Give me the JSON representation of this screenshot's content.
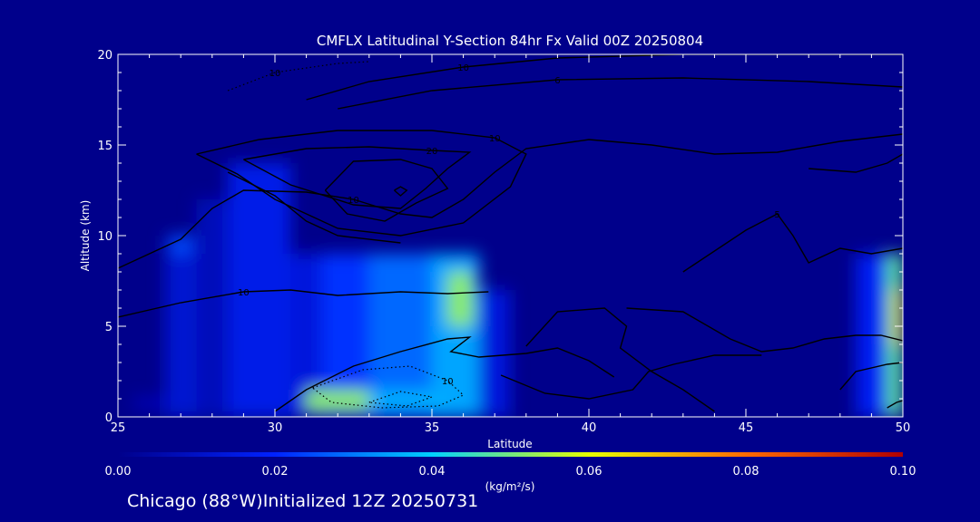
{
  "chart_data": {
    "type": "heatmap",
    "title": "CMFLX Latitudinal Y-Section 84hr  Fx Valid 00Z 20250804",
    "xlabel": "Latitude",
    "ylabel": "Altitude (km)",
    "xlim": [
      25,
      50
    ],
    "ylim": [
      0,
      20
    ],
    "x_ticks": [
      "25",
      "30",
      "35",
      "40",
      "45",
      "50"
    ],
    "y_ticks": [
      "0",
      "5",
      "10",
      "15",
      "20"
    ],
    "colorbar": {
      "ticks": [
        "0.00",
        "0.02",
        "0.04",
        "0.06",
        "0.08",
        "0.10"
      ],
      "range": [
        0,
        0.1
      ],
      "unit_label": "(kg/m²/s)"
    },
    "field_cells": [
      {
        "lat": [
          25.5,
          26.5
        ],
        "alt": [
          0.5,
          1.0
        ],
        "v": 0.01
      },
      {
        "lat": [
          26.5,
          27.5
        ],
        "alt": [
          0,
          10
        ],
        "v": 0.012
      },
      {
        "lat": [
          27.5,
          28.5
        ],
        "alt": [
          0,
          12
        ],
        "v": 0.008
      },
      {
        "lat": [
          28.5,
          30.5
        ],
        "alt": [
          0,
          14
        ],
        "v": 0.016
      },
      {
        "lat": [
          30.5,
          31.5
        ],
        "alt": [
          0,
          9
        ],
        "v": 0.014
      },
      {
        "lat": [
          31.5,
          33
        ],
        "alt": [
          0,
          9
        ],
        "v": 0.022
      },
      {
        "lat": [
          33,
          35
        ],
        "alt": [
          0,
          9
        ],
        "v": 0.028
      },
      {
        "lat": [
          35,
          36.5
        ],
        "alt": [
          0,
          9
        ],
        "v": 0.035
      },
      {
        "lat": [
          36.5,
          37.5
        ],
        "alt": [
          0,
          7
        ],
        "v": 0.014
      },
      {
        "lat": [
          31,
          33
        ],
        "alt": [
          0.3,
          1.5
        ],
        "v": 0.052
      },
      {
        "lat": [
          33,
          35.5
        ],
        "alt": [
          0.3,
          1.5
        ],
        "v": 0.036
      },
      {
        "lat": [
          35.5,
          36.3
        ],
        "alt": [
          5,
          8
        ],
        "v": 0.052
      },
      {
        "lat": [
          26.7,
          27.3
        ],
        "alt": [
          9,
          10
        ],
        "v": 0.025
      },
      {
        "lat": [
          48.5,
          49.5
        ],
        "alt": [
          0,
          9
        ],
        "v": 0.018
      },
      {
        "lat": [
          49.5,
          50
        ],
        "alt": [
          0,
          9
        ],
        "v": 0.048
      },
      {
        "lat": [
          49.7,
          50
        ],
        "alt": [
          4,
          7
        ],
        "v": 0.062
      }
    ],
    "contours": [
      {
        "label": "10",
        "points": [
          [
            25,
            8.2
          ],
          [
            27,
            9.8
          ],
          [
            28,
            11.5
          ],
          [
            29,
            12.5
          ],
          [
            31,
            12.4
          ],
          [
            32.5,
            12.0
          ],
          [
            34,
            11.2
          ],
          [
            35,
            11.0
          ],
          [
            36,
            12.0
          ],
          [
            37,
            13.5
          ],
          [
            38,
            14.8
          ],
          [
            40,
            15.3
          ],
          [
            42,
            15.0
          ],
          [
            44,
            14.5
          ],
          [
            46,
            14.6
          ],
          [
            48,
            15.2
          ],
          [
            50,
            15.6
          ]
        ]
      },
      {
        "label": "10",
        "points": [
          [
            31,
            17.5
          ],
          [
            33,
            18.5
          ],
          [
            36,
            19.3
          ],
          [
            39,
            19.8
          ],
          [
            43,
            20.0
          ],
          [
            47,
            20.0
          ],
          [
            50,
            20.0
          ]
        ]
      },
      {
        "label": "6",
        "points": [
          [
            32,
            17.0
          ],
          [
            35,
            18.0
          ],
          [
            39,
            18.6
          ],
          [
            43,
            18.7
          ],
          [
            47,
            18.5
          ],
          [
            50,
            18.2
          ]
        ]
      },
      {
        "label": "10",
        "points": [
          [
            27.5,
            14.5
          ],
          [
            29.5,
            15.3
          ],
          [
            32,
            15.8
          ],
          [
            35,
            15.8
          ],
          [
            37,
            15.4
          ],
          [
            38,
            14.5
          ],
          [
            37.5,
            12.7
          ],
          [
            36,
            10.7
          ],
          [
            34,
            10.0
          ],
          [
            32,
            10.4
          ],
          [
            30,
            12.0
          ],
          [
            28.8,
            13.4
          ],
          [
            27.5,
            14.5
          ]
        ]
      },
      {
        "label": "20",
        "points": [
          [
            29,
            14.2
          ],
          [
            31,
            14.8
          ],
          [
            33,
            14.9
          ],
          [
            35,
            14.7
          ],
          [
            36.2,
            14.6
          ],
          [
            35.5,
            13.7
          ],
          [
            34.8,
            12.6
          ],
          [
            34,
            11.5
          ],
          [
            32.5,
            11.7
          ],
          [
            30.5,
            12.8
          ],
          [
            29,
            14.2
          ]
        ]
      },
      {
        "label": "",
        "points": [
          [
            31.6,
            12.5
          ],
          [
            32.5,
            14.1
          ],
          [
            34,
            14.2
          ],
          [
            35,
            13.7
          ],
          [
            35.5,
            12.6
          ],
          [
            34.5,
            11.8
          ],
          [
            33.5,
            10.8
          ],
          [
            32.3,
            11.2
          ],
          [
            31.6,
            12.5
          ]
        ]
      },
      {
        "label": "",
        "points": [
          [
            33.8,
            12.5
          ],
          [
            34,
            12.7
          ],
          [
            34.2,
            12.5
          ],
          [
            34,
            12.2
          ],
          [
            33.8,
            12.5
          ]
        ]
      },
      {
        "label": "10",
        "points": [
          [
            25,
            5.5
          ],
          [
            27,
            6.3
          ],
          [
            29,
            6.9
          ],
          [
            30.5,
            7.0
          ],
          [
            32,
            6.7
          ],
          [
            34,
            6.9
          ],
          [
            35.5,
            6.8
          ],
          [
            36.8,
            6.9
          ]
        ]
      },
      {
        "label": "",
        "points": [
          [
            28.5,
            13.5
          ],
          [
            30,
            12.2
          ],
          [
            31,
            10.8
          ],
          [
            32,
            10.0
          ],
          [
            34,
            9.6
          ]
        ]
      },
      {
        "label": "",
        "points": [
          [
            30,
            0.3
          ],
          [
            31,
            1.5
          ],
          [
            32.5,
            2.8
          ],
          [
            34,
            3.6
          ],
          [
            35.5,
            4.3
          ],
          [
            36.2,
            4.4
          ],
          [
            35.6,
            3.6
          ],
          [
            36.5,
            3.3
          ],
          [
            38,
            3.5
          ],
          [
            39,
            3.8
          ],
          [
            40,
            3.1
          ],
          [
            40.8,
            2.2
          ]
        ]
      },
      {
        "label": "",
        "points": [
          [
            38,
            3.9
          ],
          [
            39,
            5.8
          ],
          [
            40.5,
            6.0
          ],
          [
            41.2,
            5.0
          ],
          [
            41,
            3.8
          ],
          [
            42,
            2.5
          ],
          [
            43,
            1.5
          ],
          [
            44,
            0.3
          ]
        ]
      },
      {
        "label": "",
        "points": [
          [
            37.2,
            2.3
          ],
          [
            38.6,
            1.3
          ],
          [
            40,
            1.0
          ],
          [
            41.4,
            1.5
          ],
          [
            41.9,
            2.5
          ],
          [
            42.7,
            2.9
          ],
          [
            44,
            3.4
          ],
          [
            45.5,
            3.4
          ]
        ]
      },
      {
        "label": "",
        "points": [
          [
            41.2,
            6.0
          ],
          [
            43,
            5.8
          ],
          [
            44.5,
            4.3
          ],
          [
            45.5,
            3.6
          ],
          [
            46.5,
            3.8
          ],
          [
            47.5,
            4.3
          ],
          [
            48.5,
            4.5
          ],
          [
            49.3,
            4.5
          ],
          [
            50,
            4.2
          ]
        ]
      },
      {
        "label": "5",
        "points": [
          [
            43,
            8.0
          ],
          [
            45,
            10.3
          ],
          [
            46,
            11.2
          ],
          [
            46.5,
            10.0
          ],
          [
            47,
            8.5
          ],
          [
            48,
            9.3
          ],
          [
            49,
            9.0
          ],
          [
            50,
            9.3
          ]
        ]
      },
      {
        "label": "",
        "points": [
          [
            47,
            13.7
          ],
          [
            48.5,
            13.5
          ],
          [
            49.5,
            14.0
          ],
          [
            50,
            14.5
          ]
        ]
      },
      {
        "label": "",
        "points": [
          [
            48,
            1.5
          ],
          [
            48.5,
            2.5
          ],
          [
            49.5,
            2.9
          ],
          [
            50,
            3.0
          ]
        ]
      },
      {
        "label": "",
        "points": [
          [
            49.5,
            0.5
          ],
          [
            49.8,
            0.8
          ],
          [
            50,
            0.9
          ]
        ]
      }
    ],
    "dotted_contours": [
      {
        "label": "10",
        "points": [
          [
            31.2,
            1.6
          ],
          [
            32.8,
            2.6
          ],
          [
            34.3,
            2.8
          ],
          [
            35.5,
            2.0
          ],
          [
            36,
            1.2
          ],
          [
            35.2,
            0.6
          ],
          [
            33.4,
            0.5
          ],
          [
            31.8,
            0.8
          ],
          [
            31.2,
            1.6
          ]
        ]
      },
      {
        "label": "",
        "points": [
          [
            33,
            0.8
          ],
          [
            34,
            1.4
          ],
          [
            35,
            1.1
          ],
          [
            34.2,
            0.6
          ],
          [
            33,
            0.8
          ]
        ]
      },
      {
        "label": "10",
        "points": [
          [
            28.5,
            18.0
          ],
          [
            30,
            19.0
          ],
          [
            32,
            19.5
          ],
          [
            33,
            19.6
          ]
        ]
      }
    ]
  },
  "footer": {
    "location_text": "Chicago (88°W)Initialized 12Z 20250731"
  }
}
